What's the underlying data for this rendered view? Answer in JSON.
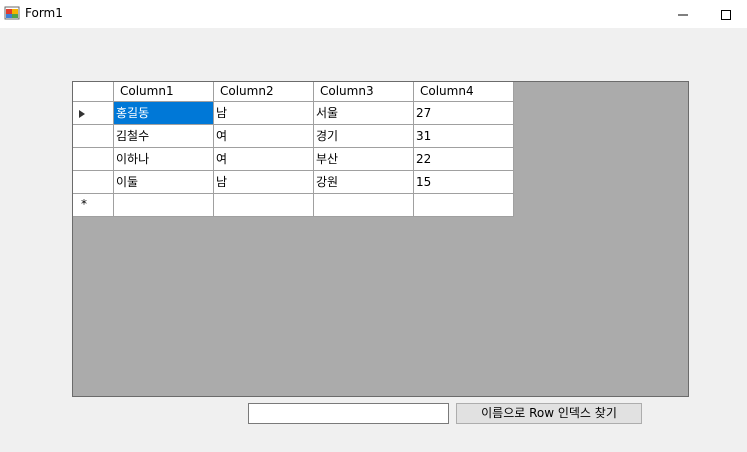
{
  "window": {
    "title": "Form1"
  },
  "grid": {
    "columns": [
      "Column1",
      "Column2",
      "Column3",
      "Column4"
    ],
    "rows": [
      [
        "홍길동",
        "남",
        "서울",
        "27"
      ],
      [
        "김철수",
        "여",
        "경기",
        "31"
      ],
      [
        "이하나",
        "여",
        "부산",
        "22"
      ],
      [
        "이둘",
        "남",
        "강원",
        "15"
      ]
    ],
    "new_row_marker": "*",
    "selected_cell": "홍길동"
  },
  "search": {
    "value": "",
    "button_label": "이름으로 Row 인덱스 찾기"
  },
  "colors": {
    "selection": "#0078d7",
    "grid_background": "#ababab",
    "form_background": "#f0f0f0"
  }
}
